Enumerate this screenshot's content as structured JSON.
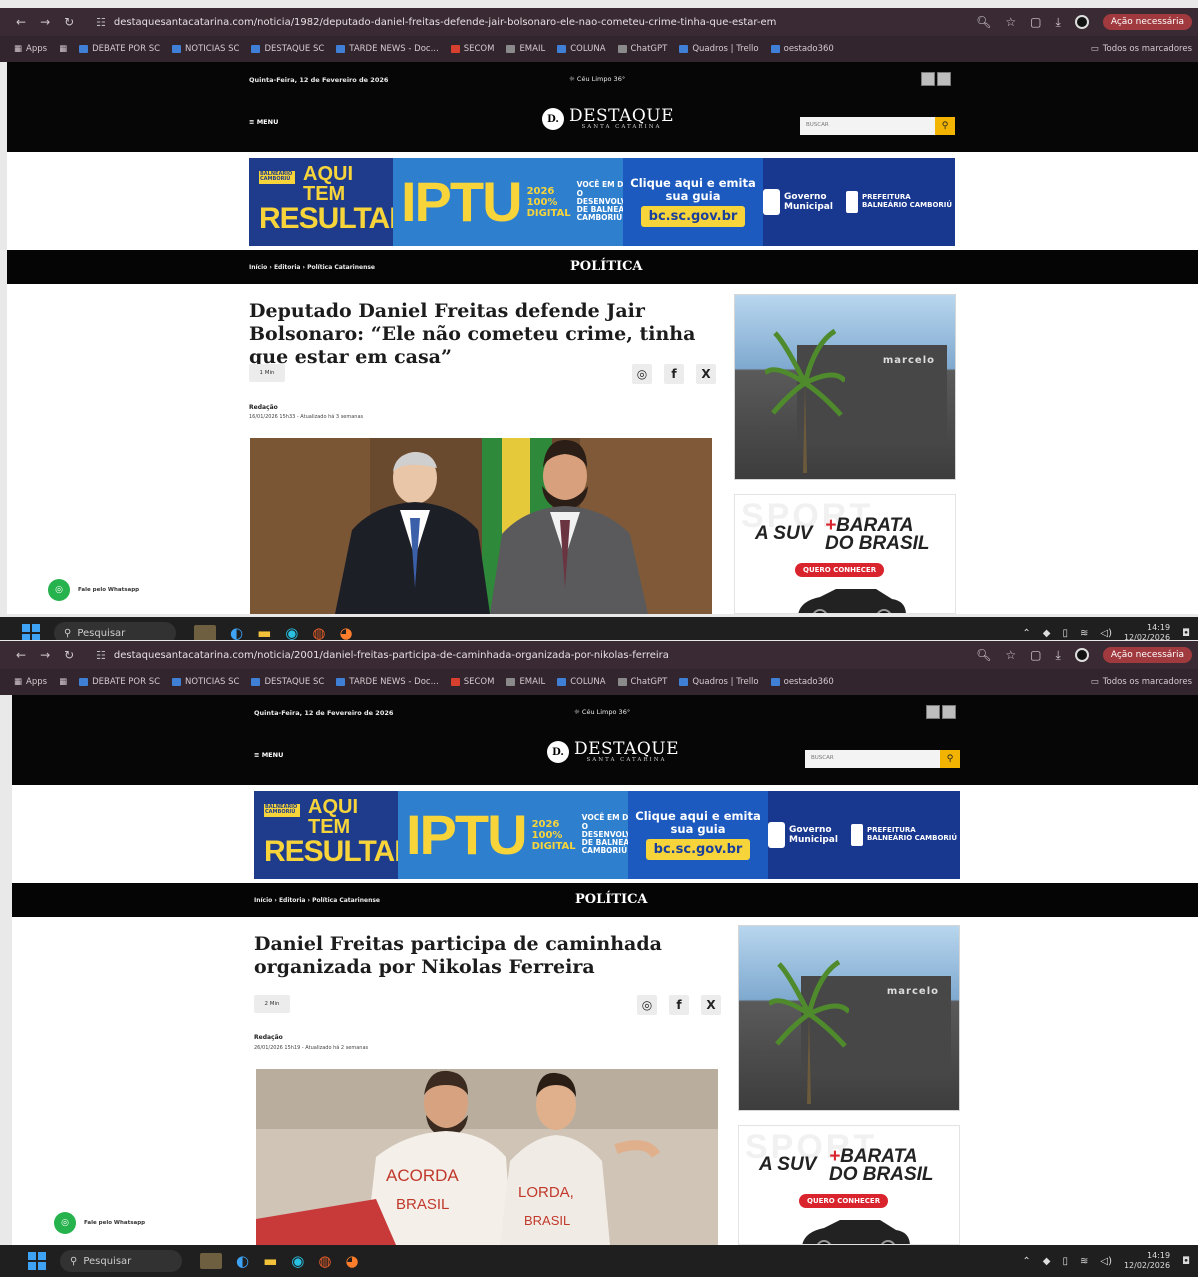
{
  "screens": [
    {
      "url": "destaquesantacatarina.com/noticia/1982/deputado-daniel-freitas-defende-jair-bolsonaro-ele-nao-cometeu-crime-tinha-que-estar-em",
      "headline": "Deputado Daniel Freitas defende Jair Bolsonaro: “Ele não cometeu crime, tinha que estar em casa”",
      "read_time": "1 Min",
      "author": "Redação",
      "date": "16/01/2026 15h33 - Atualizado há 3 semanas"
    },
    {
      "url": "destaquesantacatarina.com/noticia/2001/daniel-freitas-participa-de-caminhada-organizada-por-nikolas-ferreira",
      "headline": "Daniel Freitas participa de caminhada organizada por Nikolas Ferreira",
      "read_time": "2 Min",
      "author": "Redação",
      "date": "26/01/2026 15h19 - Atualizado há 2 semanas"
    }
  ],
  "browser": {
    "acao": "Ação necessária",
    "apps": "Apps",
    "bookmarks": [
      "DEBATE POR SC",
      "NOTICIAS SC",
      "DESTAQUE SC",
      "TARDE NEWS - Doc...",
      "SECOM",
      "EMAIL",
      "COLUNA",
      "ChatGPT",
      "Quadros | Trello",
      "oestado360"
    ],
    "all_bookmarks": "Todos os marcadores"
  },
  "site": {
    "date_line": "Quinta-Feira, 12 de Fevereiro de 2026",
    "weather": "Céu Limpo 36°",
    "menu": "MENU",
    "logo_letter": "D.",
    "logo_name": "DESTAQUE",
    "logo_sub": "SANTA CATARINA",
    "search_placeholder": "BUSCAR",
    "crumbs": "Início  ›  Editoria  ›  Política Catarinense",
    "category": "POLÍTICA",
    "whatsapp": "Fale pelo Whatsapp"
  },
  "banner": {
    "tag": "BALNEÁRIO CAMBORIÚ",
    "aqui": "AQUI TEM",
    "resultado": "RESULTADO",
    "iptu": "IPTU",
    "year": "2026",
    "digital": "100% DIGITAL",
    "text": "VOCÊ EM DIA COM O DESENVOLVIMENTO DE BALNEÁRIO CAMBORIÚ",
    "clique": "Clique aqui e emita sua guia",
    "site": "bc.sc.gov.br",
    "governo": "Governo Municipal",
    "prefeitura": "PREFEITURA BALNEÁRIO CAMBORIÚ"
  },
  "side_ad": {
    "bg": "SPORT",
    "a_suv": "A SUV",
    "plus": "+",
    "barata": "BARATA",
    "do_brasil": "DO BRASIL",
    "cta": "QUERO CONHECER"
  },
  "side_building_text": "marcelo",
  "photo2_text": {
    "shirt1": "ACORDA BRASIL",
    "shirt2": "ACORDA, BRASIL"
  },
  "taskbar": {
    "search": "Pesquisar",
    "time": "14:19",
    "date": "12/02/2026"
  }
}
